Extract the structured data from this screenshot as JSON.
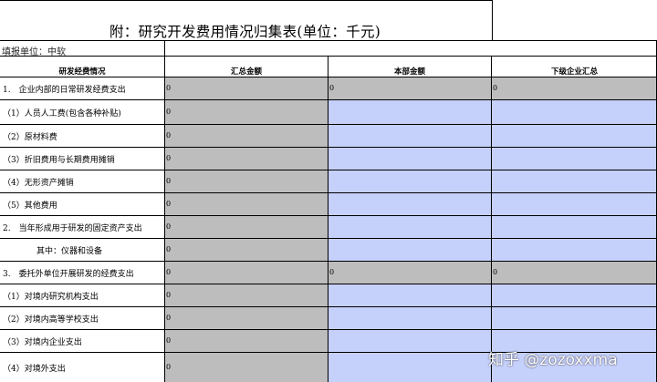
{
  "title": "附：研究开发费用情况归集表(单位：千元)",
  "reporting_unit": "填报单位：中软",
  "headers": [
    "研发经费情况",
    "汇总金额",
    "本部金额",
    "下级企业汇总"
  ],
  "rows": [
    {
      "label": "1.　企业内部的日常研发经费支出",
      "values": [
        "0",
        "0",
        "0"
      ],
      "style": "total"
    },
    {
      "label": "（1）人员人工费(包含各种补贴)",
      "values": [
        "0",
        "",
        ""
      ],
      "style": "detail"
    },
    {
      "label": "（2）原材料费",
      "values": [
        "0",
        "",
        ""
      ],
      "style": "detail"
    },
    {
      "label": "（3）折旧费用与长期费用摊销",
      "values": [
        "0",
        "",
        ""
      ],
      "style": "detail"
    },
    {
      "label": "（4）无形资产摊销",
      "values": [
        "0",
        "",
        ""
      ],
      "style": "detail"
    },
    {
      "label": "（5）其他费用",
      "values": [
        "0",
        "",
        ""
      ],
      "style": "detail"
    },
    {
      "label": "2.　当年形成用于研发的固定资产支出",
      "values": [
        "0",
        "",
        ""
      ],
      "style": "detail"
    },
    {
      "label": "其中：仪器和设备",
      "values": [
        "0",
        "",
        ""
      ],
      "style": "detail",
      "indent": true
    },
    {
      "label": "3.　委托外单位开展研发的经费支出",
      "values": [
        "0",
        "0",
        "0"
      ],
      "style": "total"
    },
    {
      "label": "（1）对境内研究机构支出",
      "values": [
        "0",
        "",
        ""
      ],
      "style": "detail"
    },
    {
      "label": "（2）对境内高等学校支出",
      "values": [
        "0",
        "",
        ""
      ],
      "style": "detail"
    },
    {
      "label": "（3）对境内企业支出",
      "values": [
        "0",
        "",
        ""
      ],
      "style": "detail"
    },
    {
      "label": "（4）对境外支出",
      "values": [
        "0",
        "",
        ""
      ],
      "style": "detail"
    }
  ],
  "watermark": "知乎 @zozoxxma",
  "colors": {
    "total_fill": "#bdbdbd",
    "gray_fill": "#bdbdbd",
    "blue_fill": "#c5d0fb",
    "grid": "#000000"
  }
}
